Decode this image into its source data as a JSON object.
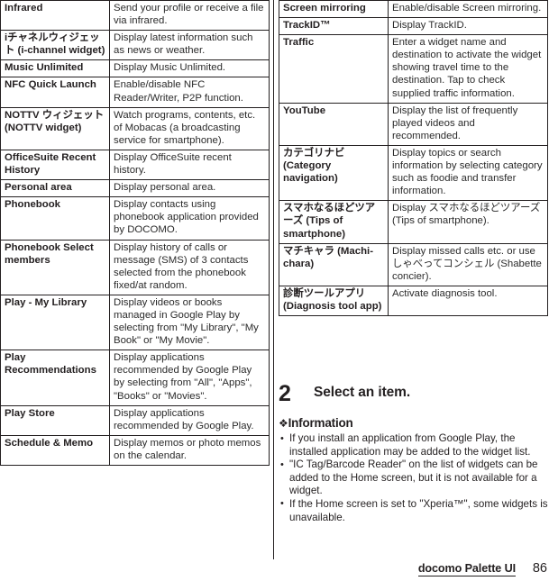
{
  "document": {
    "footer": {
      "title": "docomo Palette UI",
      "page_number": "86"
    }
  },
  "left_table": {
    "rows": [
      {
        "name": "Infrared",
        "description": "Send your profile or receive a file via infrared."
      },
      {
        "name": "iチャネルウィジェット (i-channel widget)",
        "description": "Display latest information such as news or weather."
      },
      {
        "name": "Music Unlimited",
        "description": "Display Music Unlimited."
      },
      {
        "name": "NFC Quick Launch",
        "description": "Enable/disable NFC Reader/Writer, P2P function."
      },
      {
        "name": "NOTTV ウィジェット (NOTTV widget)",
        "description": "Watch programs, contents, etc. of Mobacas (a broadcasting service for smartphone)."
      },
      {
        "name": "OfficeSuite Recent History",
        "description": "Display OfficeSuite recent history."
      },
      {
        "name": "Personal area",
        "description": "Display personal area."
      },
      {
        "name": "Phonebook",
        "description": "Display contacts using phonebook application provided by DOCOMO."
      },
      {
        "name": "Phonebook Select members",
        "description": "Display history of calls or message (SMS) of 3 contacts selected from the phonebook fixed/at random."
      },
      {
        "name": "Play - My Library",
        "description": "Display videos or books managed in Google Play by selecting from \"My Library\", \"My Book\" or \"My Movie\"."
      },
      {
        "name": "Play Recommendations",
        "description": "Display applications recommended by Google Play by selecting from \"All\", \"Apps\", \"Books\" or \"Movies\"."
      },
      {
        "name": "Play Store",
        "description": "Display applications recommended by Google Play."
      },
      {
        "name": "Schedule & Memo",
        "description": "Display memos or photo memos on the calendar."
      }
    ]
  },
  "right_table": {
    "rows": [
      {
        "name": "Screen mirroring",
        "description": "Enable/disable Screen mirroring."
      },
      {
        "name": "TrackID™",
        "description": "Display TrackID."
      },
      {
        "name": "Traffic",
        "description": "Enter a widget name and destination to activate the widget showing travel time to the destination. Tap to check supplied traffic information."
      },
      {
        "name": "YouTube",
        "description": "Display the list of frequently played videos and recommended."
      },
      {
        "name": "カテゴリナビ (Category navigation)",
        "description": "Display topics or search information by selecting category such as foodie and transfer information."
      },
      {
        "name": "スマホなるほどツアーズ (Tips of smartphone)",
        "description": "Display スマホなるほどツアーズ (Tips of smartphone)."
      },
      {
        "name": "マチキャラ (Machi-chara)",
        "description": "Display missed calls etc. or use しゃべってコンシェル (Shabette concier)."
      },
      {
        "name": "診断ツールアプリ (Diagnosis tool app)",
        "description": "Activate diagnosis tool."
      }
    ]
  },
  "step": {
    "number": "2",
    "text": "Select an item."
  },
  "information": {
    "diamond": "❖",
    "heading": "Information",
    "items": [
      "If you install an application from Google Play, the installed application may be added to the widget list.",
      "\"IC Tag/Barcode Reader\" on the list of widgets can be added to the Home screen, but it is not available for a widget.",
      "If the Home screen is set to \"Xperia™\", some widgets is unavailable."
    ]
  }
}
